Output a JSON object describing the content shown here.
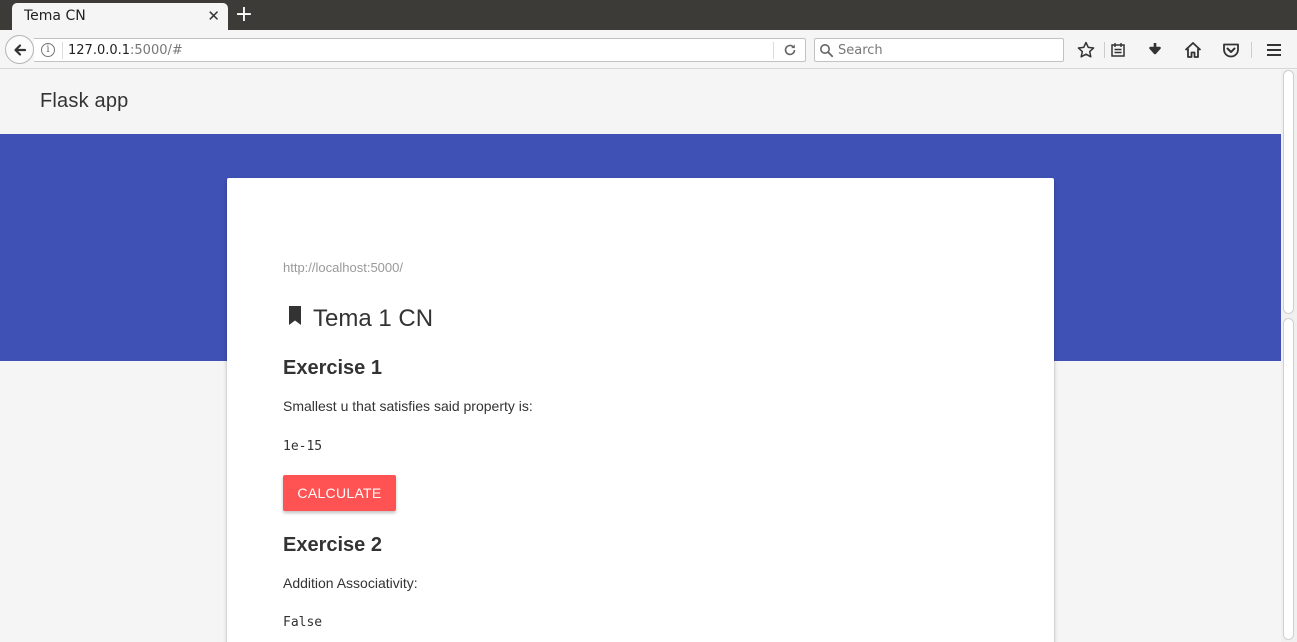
{
  "browser": {
    "tab_title": "Tema CN",
    "tab_close": "✕",
    "new_tab": "+",
    "url_host": "127.0.0.1",
    "url_rest": ":5000/#",
    "search_placeholder": "Search"
  },
  "app": {
    "title": "Flask app"
  },
  "card": {
    "host_link": "http://localhost:5000/",
    "title": "Tema 1 CN",
    "exercise1": {
      "heading": "Exercise 1",
      "text": "Smallest u that satisfies said property is:",
      "result": "1e-15",
      "button": "CALCULATE"
    },
    "exercise2": {
      "heading": "Exercise 2",
      "text": "Addition Associativity:",
      "result": "False"
    }
  },
  "colors": {
    "hero": "#3f51b5",
    "accent_button": "#ff5252"
  },
  "icons": [
    "back-arrow-icon",
    "info-icon",
    "reload-icon",
    "search-icon",
    "star-icon",
    "reading-list-icon",
    "download-icon",
    "home-icon",
    "pocket-icon",
    "menu-icon",
    "bookmark-icon"
  ]
}
